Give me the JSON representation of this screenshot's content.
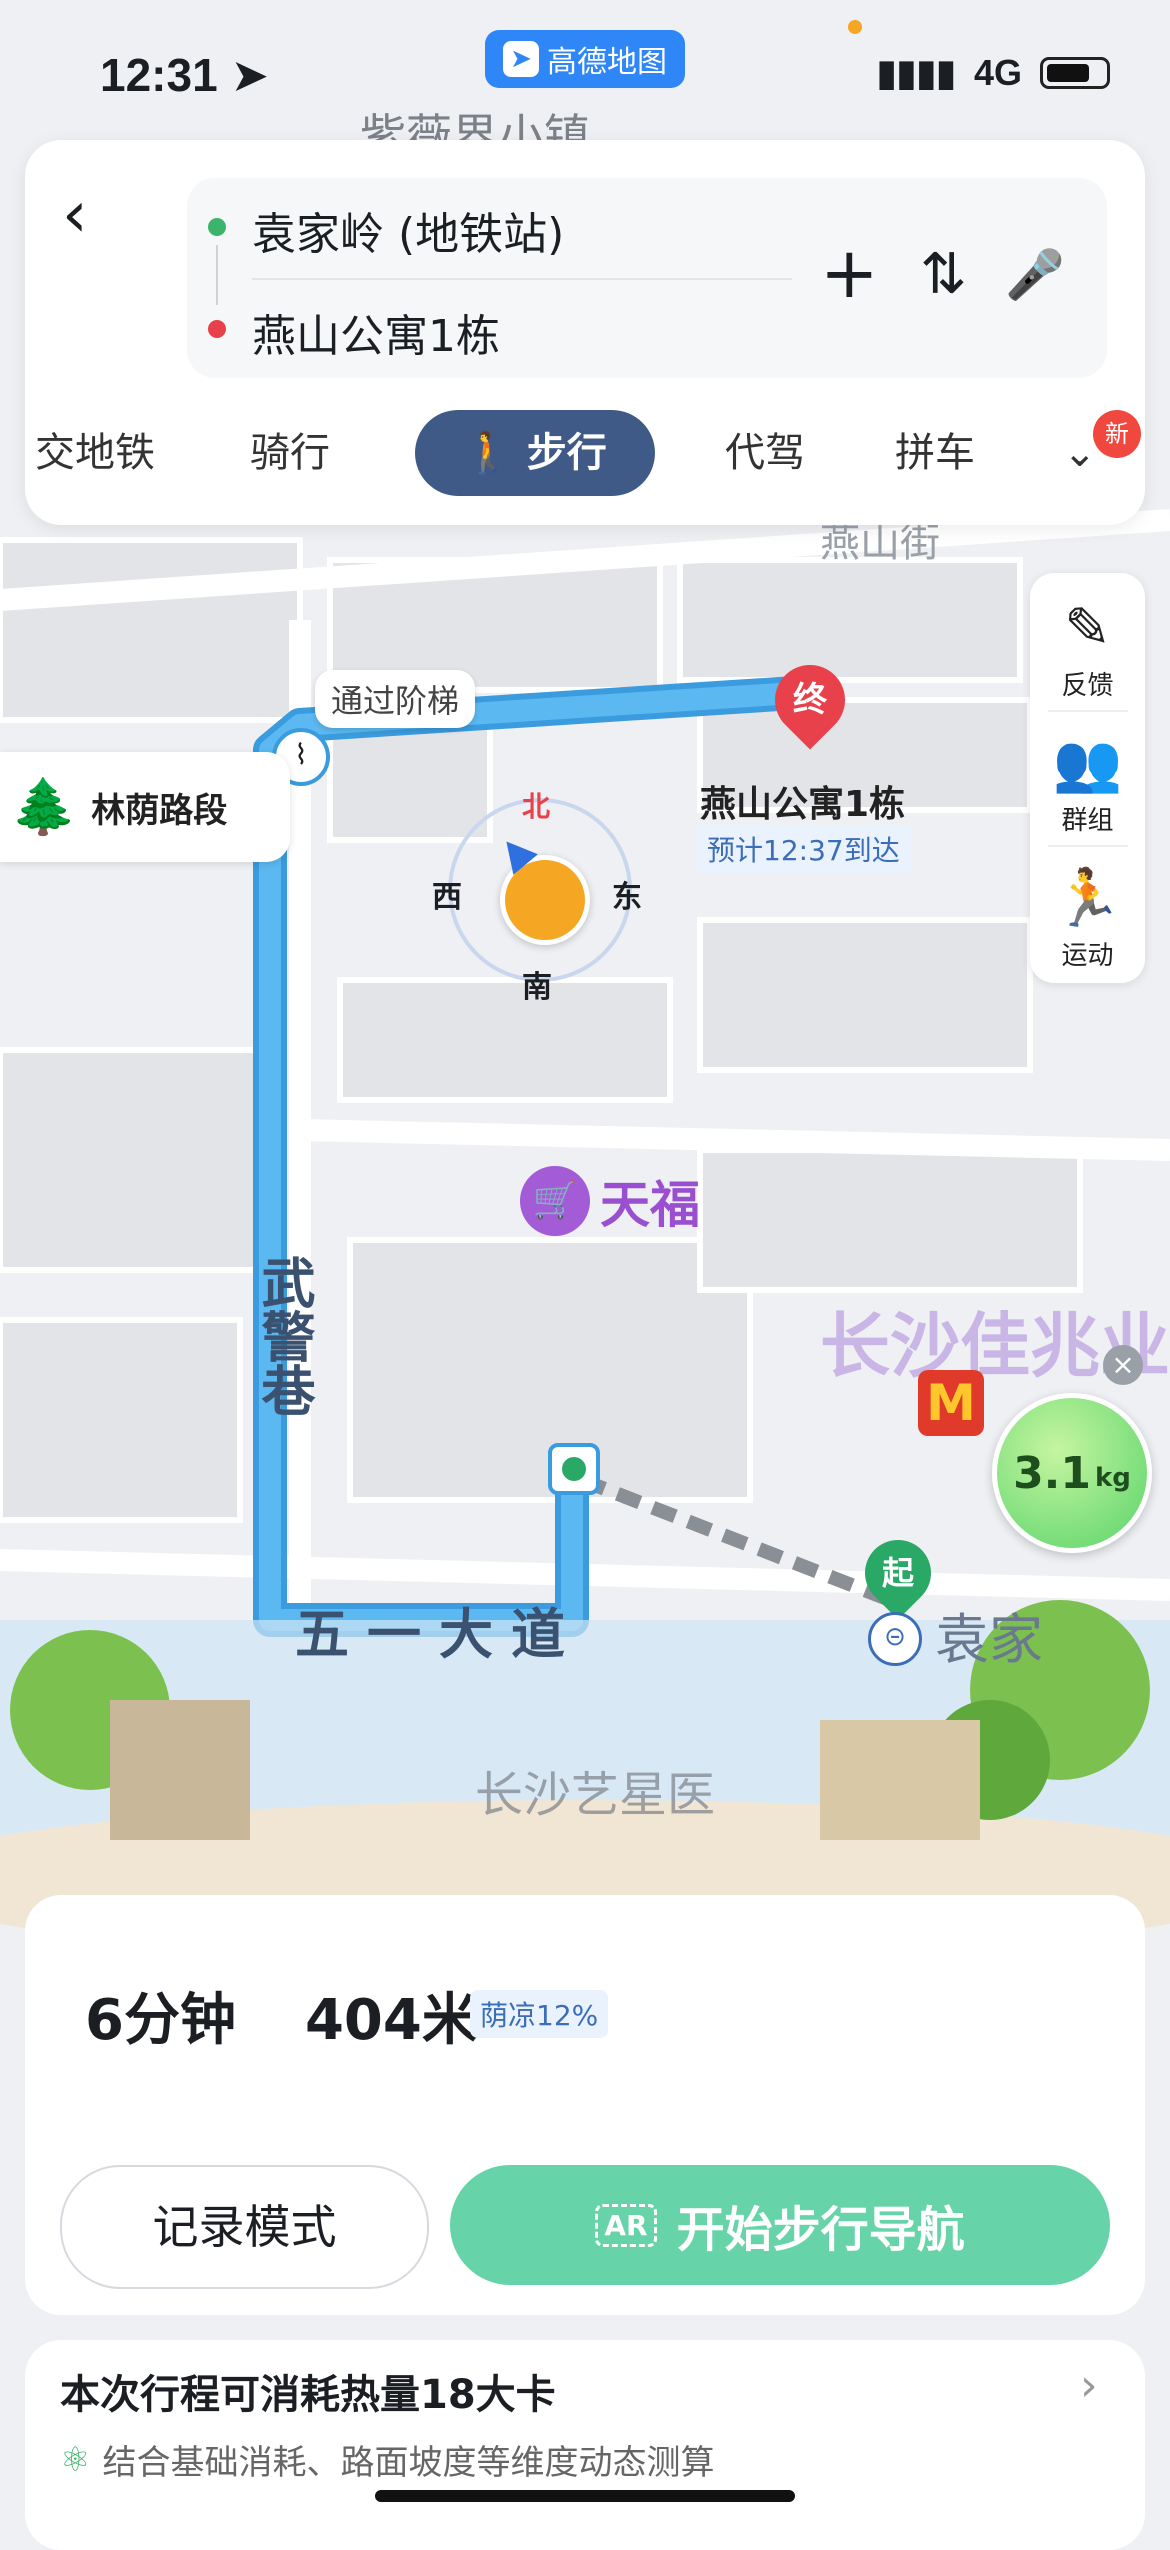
{
  "status": {
    "time": "12:31",
    "app_badge": "高德地图",
    "network": "4G"
  },
  "route": {
    "origin": "袁家岭 (地铁站)",
    "destination": "燕山公寓1栋",
    "actions": {
      "add": "+",
      "swap": "⇅",
      "voice": "🎤"
    },
    "tabs": [
      "交地铁",
      "骑行",
      "步行",
      "代驾",
      "拼车"
    ],
    "active_tab": "步行",
    "new_badge": "新"
  },
  "map": {
    "top_place": "紫薇界小镇",
    "road_yanshan": "燕山街",
    "stairs_hint": "通过阶梯",
    "shade_segment": "林荫路段",
    "end_marker": "终",
    "end_name": "燕山公寓1栋",
    "eta": "预计12:37到达",
    "compass": {
      "n": "北",
      "s": "南",
      "w": "西",
      "e": "东"
    },
    "poi_tianfu": "天福",
    "poi_mall": "长沙佳兆业",
    "road_wujing": "武警巷",
    "road_wuyi": "五一大道",
    "start_marker": "起",
    "station_label": "袁家",
    "hospital_label": "长沙艺星医",
    "carbon": "3.1",
    "carbon_unit": "kg"
  },
  "side_tools": [
    {
      "label": "反馈",
      "icon": "edit-icon"
    },
    {
      "label": "群组",
      "icon": "group-icon"
    },
    {
      "label": "运动",
      "icon": "run-icon"
    }
  ],
  "summary": {
    "duration": "6分钟",
    "distance": "404米",
    "shade": "荫凉12%"
  },
  "buttons": {
    "record": "记录模式",
    "start": "开始步行导航",
    "ar": "AR"
  },
  "calorie": {
    "title": "本次行程可消耗热量18大卡",
    "subtitle": "结合基础消耗、路面坡度等维度动态测算"
  }
}
